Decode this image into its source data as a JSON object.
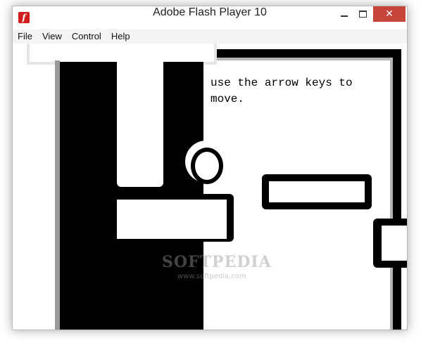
{
  "window": {
    "title": "Adobe Flash Player 10",
    "app_icon": "flash-icon",
    "app_icon_glyph": "f",
    "close_glyph": "✕"
  },
  "menu": {
    "items": [
      "File",
      "View",
      "Control",
      "Help"
    ]
  },
  "game": {
    "instructions": "use the arrow keys to\nmove."
  },
  "watermark": {
    "brand": "SOFTPEDIA",
    "url": "www.softpedia.com"
  },
  "colors": {
    "ink": "#000000",
    "paper": "#ffffff",
    "close_button": "#c7443a"
  }
}
